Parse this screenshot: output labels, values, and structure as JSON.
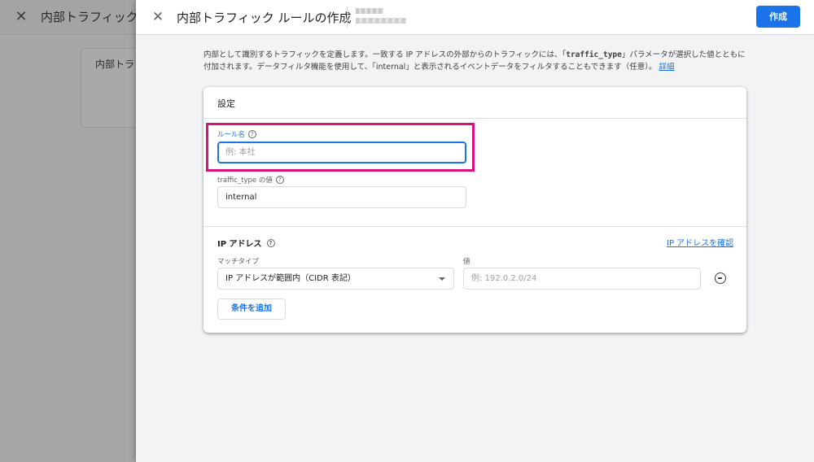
{
  "background": {
    "title": "内部トラフィックの",
    "card_label": "内部トラフ"
  },
  "header": {
    "title": "内部トラフィック ルールの作成",
    "create_label": "作成"
  },
  "description": {
    "part1": "内部として識別するトラフィックを定義します。一致する IP アドレスの外部からのトラフィックには、「",
    "code": "traffic_type",
    "part2": "」パラメータが選択した値とともに付加されます。データフィルタ機能を使用して、「internal」と表示されるイベントデータをフィルタすることもできます（任意）。",
    "link": "詳細"
  },
  "settings": {
    "title": "設定",
    "rule_name": {
      "label": "ルール名",
      "placeholder": "例: 本社",
      "value": ""
    },
    "traffic_type": {
      "label": "traffic_type の値",
      "value": "internal"
    }
  },
  "ip_section": {
    "title": "IP アドレス",
    "check_link": "IP アドレスを確認",
    "match_type_label": "マッチタイプ",
    "match_type_value": "IP アドレスが範囲内（CIDR 表記）",
    "value_label": "値",
    "value_placeholder": "例: 192.0.2.0/24",
    "add_condition_label": "条件を追加"
  },
  "icons": {
    "close": "close-icon",
    "help": "help-icon",
    "caret": "chevron-down-icon",
    "remove": "remove-circle-icon"
  },
  "colors": {
    "accent": "#1a73e8",
    "highlight": "#d7137a"
  }
}
